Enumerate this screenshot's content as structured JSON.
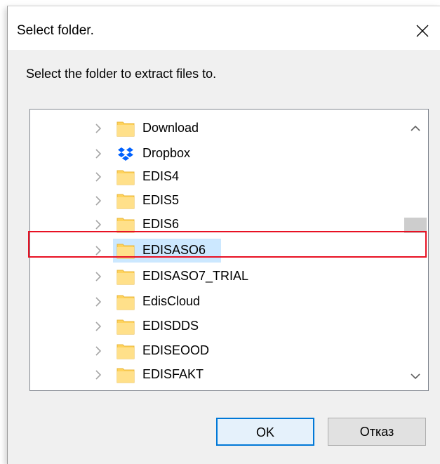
{
  "dialog": {
    "title": "Select folder.",
    "instruction": "Select the folder to extract files to."
  },
  "tree": {
    "items": [
      {
        "label": "Download",
        "icon": "folder-icon"
      },
      {
        "label": "Dropbox",
        "icon": "dropbox-icon"
      },
      {
        "label": "EDIS4",
        "icon": "folder-icon"
      },
      {
        "label": "EDIS5",
        "icon": "folder-icon"
      },
      {
        "label": "EDIS6",
        "icon": "folder-icon"
      },
      {
        "label": "EDISASO6",
        "icon": "folder-icon",
        "selected": true
      },
      {
        "label": "EDISASO7_TRIAL",
        "icon": "folder-icon"
      },
      {
        "label": "EdisCloud",
        "icon": "folder-icon"
      },
      {
        "label": "EDISDDS",
        "icon": "folder-icon"
      },
      {
        "label": "EDISEOOD",
        "icon": "folder-icon"
      },
      {
        "label": "EDISFAKT",
        "icon": "folder-icon"
      }
    ]
  },
  "buttons": {
    "ok_label": "OK",
    "cancel_label": "Отказ"
  },
  "colors": {
    "selection": "#cce8ff",
    "folder": "#ffd35c",
    "highlight_border": "#e81123",
    "default_button_border": "#0078d7"
  }
}
